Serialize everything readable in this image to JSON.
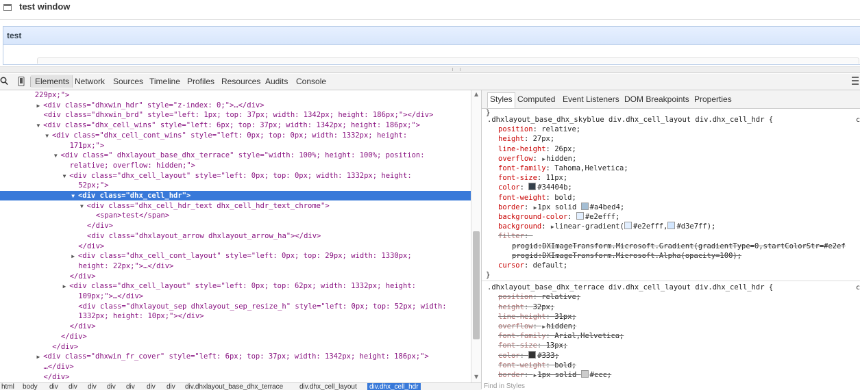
{
  "window": {
    "title": "test window"
  },
  "layout_cell": {
    "header": "test"
  },
  "devtools": {
    "tabs": [
      "Elements",
      "Network",
      "Sources",
      "Timeline",
      "Profiles",
      "Resources",
      "Audits",
      "Console"
    ],
    "active_tab": "Elements",
    "dom_lines": [
      {
        "indent": 8,
        "tri": "",
        "text": "229px;\">"
      },
      {
        "indent": 10,
        "tri": "▶",
        "text": "<div class=\"dhxwin_hdr\" style=\"z-index: 0;\">…</div>"
      },
      {
        "indent": 10,
        "tri": "",
        "text": "<div class=\"dhxwin_brd\" style=\"left: 1px; top: 37px; width: 1342px; height: 186px;\"></div>"
      },
      {
        "indent": 10,
        "tri": "▼",
        "text": "<div class=\"dhx_cell_wins\" style=\"left: 6px; top: 37px; width: 1342px; height: 186px;\">"
      },
      {
        "indent": 12,
        "tri": "▼",
        "text": "<div class=\"dhx_cell_cont_wins\" style=\"left: 0px; top: 0px; width: 1332px; height:"
      },
      {
        "indent": 16,
        "tri": "",
        "text": "171px;\">"
      },
      {
        "indent": 14,
        "tri": "▼",
        "text": "<div class=\" dhxlayout_base_dhx_terrace\" style=\"width: 100%; height: 100%; position:"
      },
      {
        "indent": 16,
        "tri": "",
        "text": "relative; overflow: hidden;\">"
      },
      {
        "indent": 16,
        "tri": "▼",
        "text": "<div class=\"dhx_cell_layout\" style=\"left: 0px; top: 0px; width: 1332px; height:"
      },
      {
        "indent": 18,
        "tri": "",
        "text": "52px;\">"
      },
      {
        "indent": 18,
        "tri": "▼",
        "text": "<div class=\"dhx_cell_hdr\">",
        "selected": true
      },
      {
        "indent": 20,
        "tri": "▼",
        "text": "<div class=\"dhx_cell_hdr_text dhx_cell_hdr_text_chrome\">"
      },
      {
        "indent": 22,
        "tri": "",
        "text": "<span>test</span>"
      },
      {
        "indent": 20,
        "tri": "",
        "text": "</div>"
      },
      {
        "indent": 20,
        "tri": "",
        "text": "<div class=\"dhxlayout_arrow dhxlayout_arrow_ha\"></div>"
      },
      {
        "indent": 18,
        "tri": "",
        "text": "</div>"
      },
      {
        "indent": 18,
        "tri": "▶",
        "text": "<div class=\"dhx_cell_cont_layout\" style=\"left: 0px; top: 29px; width: 1330px;"
      },
      {
        "indent": 18,
        "tri": "",
        "text": "height: 22px;\">…</div>"
      },
      {
        "indent": 16,
        "tri": "",
        "text": "</div>"
      },
      {
        "indent": 16,
        "tri": "▶",
        "text": "<div class=\"dhx_cell_layout\" style=\"left: 0px; top: 62px; width: 1332px; height:"
      },
      {
        "indent": 18,
        "tri": "",
        "text": "109px;\">…</div>"
      },
      {
        "indent": 18,
        "tri": "",
        "text": "<div class=\"dhxlayout_sep dhxlayout_sep_resize_h\" style=\"left: 0px; top: 52px; width:"
      },
      {
        "indent": 18,
        "tri": "",
        "text": "1332px; height: 10px;\"></div>"
      },
      {
        "indent": 16,
        "tri": "",
        "text": "</div>"
      },
      {
        "indent": 14,
        "tri": "",
        "text": "</div>"
      },
      {
        "indent": 12,
        "tri": "",
        "text": "</div>"
      },
      {
        "indent": 10,
        "tri": "▶",
        "text": "<div class=\"dhxwin_fr_cover\" style=\"left: 6px; top: 37px; width: 1342px; height: 186px;\">"
      },
      {
        "indent": 10,
        "tri": "",
        "text": "…</div>"
      },
      {
        "indent": 10,
        "tri": "",
        "text": "</div>"
      }
    ],
    "breadcrumbs": [
      "html",
      "body",
      "div",
      "div",
      "div",
      "div",
      "div",
      "div",
      "div",
      "div.dhxlayout_base_dhx_terrace",
      "div.dhx_cell_layout",
      "div.dhx_cell_hdr"
    ],
    "side_tabs": [
      "Styles",
      "Computed",
      "Event Listeners",
      "DOM Breakpoints",
      "Properties"
    ],
    "active_side_tab": "Styles",
    "rule1": {
      "selector": ".dhxlayout_base_dhx_skyblue div.dhx_cell_layout div.dhx_cell_hdr {",
      "props": [
        {
          "name": "position",
          "value": "relative;"
        },
        {
          "name": "height",
          "value": "27px;"
        },
        {
          "name": "line-height",
          "value": "26px;"
        },
        {
          "name": "overflow",
          "value": "hidden;",
          "expand": true
        },
        {
          "name": "font-family",
          "value": "Tahoma,Helvetica;"
        },
        {
          "name": "font-size",
          "value": "11px;"
        },
        {
          "name": "color",
          "value": "#34404b;",
          "swatch": "#34404b"
        },
        {
          "name": "font-weight",
          "value": "bold;"
        },
        {
          "name": "border",
          "value": "1px solid ",
          "expand": true,
          "swatch": "#a4bed4",
          "value_after": "#a4bed4;"
        },
        {
          "name": "background-color",
          "value": "#e2efff;",
          "swatch": "#e2efff"
        },
        {
          "name": "background",
          "value": "linear-gradient(",
          "expand": true,
          "value_after": "#e2efff, #d3e7ff);"
        },
        {
          "name": "filter",
          "value": "",
          "struck": true
        },
        {
          "name": "",
          "value": "progid:DXImageTransform.Microsoft.Gradient(gradientType=0,startColorStr=#e2ef",
          "struck": true,
          "filter_val": true
        },
        {
          "name": "",
          "value": "progid:DXImageTransform.Microsoft.Alpha(opacity=100);",
          "struck": true,
          "filter_val": true
        },
        {
          "name": "cursor",
          "value": "default;"
        }
      ]
    },
    "rule2": {
      "selector": ".dhxlayout_base_dhx_terrace div.dhx_cell_layout div.dhx_cell_hdr {",
      "props": [
        {
          "name": "position",
          "value": "relative;",
          "struck": true
        },
        {
          "name": "height",
          "value": "32px;",
          "struck": true
        },
        {
          "name": "line-height",
          "value": "31px;",
          "struck": true
        },
        {
          "name": "overflow",
          "value": "hidden;",
          "struck": true,
          "expand": true
        },
        {
          "name": "font-family",
          "value": "Arial,Helvetica;",
          "struck": true
        },
        {
          "name": "font-size",
          "value": "13px;",
          "struck": true
        },
        {
          "name": "color",
          "value": "#333;",
          "struck": true,
          "swatch": "#333333"
        },
        {
          "name": "font-weight",
          "value": "bold;",
          "struck": true
        },
        {
          "name": "border",
          "value": "1px solid ",
          "struck": true,
          "expand": true,
          "swatch": "#cccccc",
          "value_after": "#ccc;"
        }
      ]
    },
    "find_placeholder": "Find in Styles"
  }
}
